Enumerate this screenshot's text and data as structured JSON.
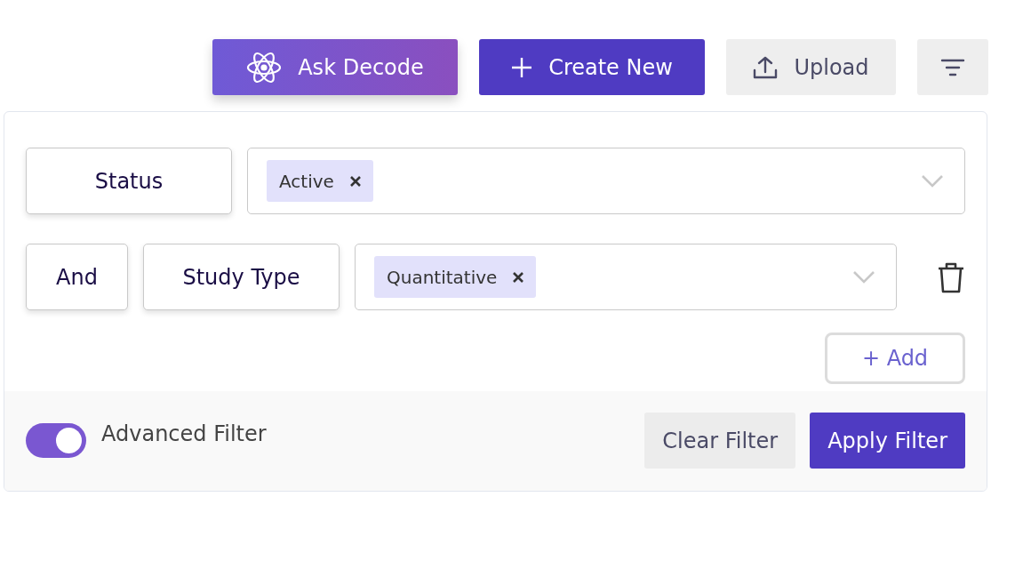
{
  "toolbar": {
    "buttons": [
      {
        "kind": "ai",
        "label": "Ask Decode"
      },
      {
        "kind": "primary",
        "label": "Create New"
      },
      {
        "kind": "upload",
        "label": "Upload"
      },
      {
        "kind": "filter"
      }
    ]
  },
  "filter_panel": {
    "rows": [
      {
        "field": "Status",
        "values": [
          "Active"
        ],
        "deletable": false
      },
      {
        "connector": "And",
        "field": "Study Type",
        "values": [
          "Quantitative"
        ],
        "deletable": true
      }
    ],
    "add_button": "+ Add",
    "advanced_filter": {
      "label": "Advanced Filter",
      "on": true
    },
    "clear_button": "Clear Filter",
    "apply_button": "Apply Filter"
  }
}
